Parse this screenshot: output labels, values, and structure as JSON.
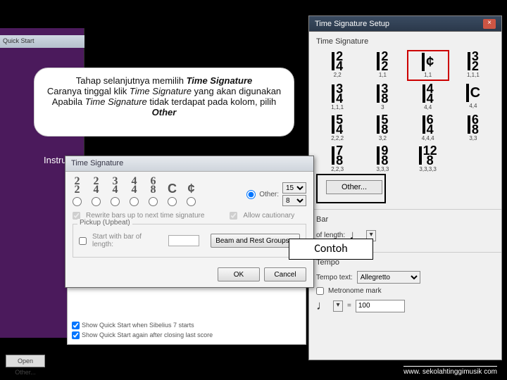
{
  "setup": {
    "title": "Time Signature Setup",
    "group_ts": "Time Signature",
    "grid": [
      {
        "top": "2",
        "bot": "4",
        "sub": "2,2"
      },
      {
        "top": "2",
        "bot": "2",
        "sub": "1,1"
      },
      {
        "top": "",
        "bot": "¢",
        "sub": "1,1"
      },
      {
        "top": "3",
        "bot": "2",
        "sub": "1,1,1"
      },
      {
        "top": "3",
        "bot": "4",
        "sub": "1,1,1"
      },
      {
        "top": "3",
        "bot": "8",
        "sub": "3"
      },
      {
        "top": "4",
        "bot": "4",
        "sub": "4,4"
      },
      {
        "top": "",
        "bot": "C",
        "sub": "4,4"
      },
      {
        "top": "5",
        "bot": "4",
        "sub": "2,2,2"
      },
      {
        "top": "5",
        "bot": "8",
        "sub": "3,2"
      },
      {
        "top": "6",
        "bot": "4",
        "sub": "4,4,4"
      },
      {
        "top": "6",
        "bot": "8",
        "sub": "3,3"
      },
      {
        "top": "7",
        "bot": "8",
        "sub": "2,2,3"
      },
      {
        "top": "9",
        "bot": "8",
        "sub": "3,3,3"
      },
      {
        "top": "12",
        "bot": "8",
        "sub": "3,3,3,3"
      }
    ],
    "other_btn": "Other...",
    "bar_group": "Bar",
    "bar_label": "of length:",
    "bar_note": "♩",
    "tempo_group": "Tempo",
    "tempo_text_label": "Tempo text:",
    "tempo_text_value": "Allegretto",
    "metronome_label": "Metronome mark",
    "metronome_note": "♩",
    "metronome_eq": "=",
    "metronome_val": "100"
  },
  "sib": {
    "toolbar": "Quick Start",
    "open_btn": "Open Other...",
    "check1": "Show Quick Start when Sibelius 7 starts",
    "check2": "Show Quick Start again after closing last score"
  },
  "callout": {
    "l1a": "Tahap selanjutnya memilih ",
    "l1b": "Time Signature",
    "l2a": "Caranya tinggal klik ",
    "l2b": "Time Signature",
    "l2c": " yang akan digunakan",
    "l3a": "Apabila ",
    "l3b": "Time Signature",
    "l3c": " tidak terdapat pada kolom, pilih ",
    "l3d": "Other"
  },
  "instrum": "Instrum",
  "dialog": {
    "title": "Time Signature",
    "radios": [
      {
        "top": "2",
        "bot": "2"
      },
      {
        "top": "2",
        "bot": "4"
      },
      {
        "top": "3",
        "bot": "4"
      },
      {
        "top": "4",
        "bot": "4"
      },
      {
        "top": "6",
        "bot": "8"
      },
      {
        "top": "",
        "bot": "C"
      },
      {
        "top": "",
        "bot": "¢"
      }
    ],
    "other_label": "Other:",
    "other_top": "15",
    "other_bot": "8",
    "rewrite": "Rewrite bars up to next time signature",
    "cautionary": "Allow cautionary",
    "pickup_group": "Pickup (Upbeat)",
    "start_bar": "Start with bar of length:",
    "beam_btn": "Beam and Rest Groups...",
    "ok": "OK",
    "cancel": "Cancel"
  },
  "contoh": "Contoh",
  "footer": "www. sekolahtinggimusik com"
}
